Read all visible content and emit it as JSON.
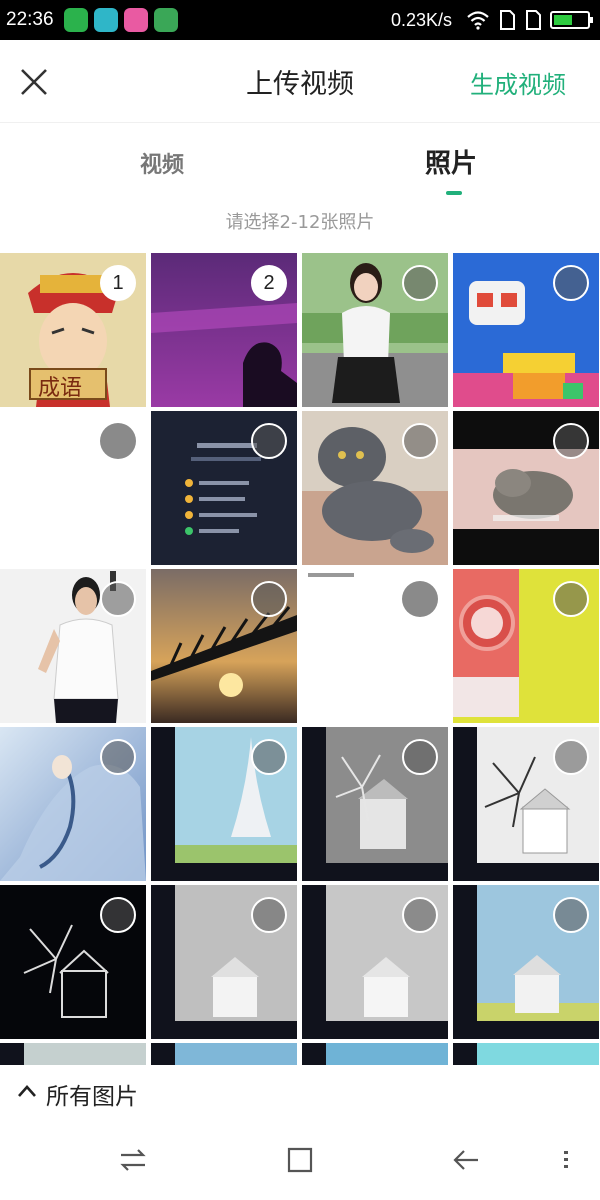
{
  "status_bar": {
    "time": "22:36",
    "speed": "0.23K/s",
    "battery_level": 0.55,
    "notification_colors": [
      "#2bb24c",
      "#2fb6c8",
      "#e95aa2",
      "#3aa757"
    ]
  },
  "header": {
    "title": "上传视频",
    "generate_label": "生成视频"
  },
  "tabs": [
    {
      "label": "视频",
      "active": false
    },
    {
      "label": "照片",
      "active": true
    }
  ],
  "hint": "请选择2-12张照片",
  "photos": [
    {
      "selected": 1
    },
    {
      "selected": 2
    },
    {
      "selected": 0
    },
    {
      "selected": 0
    },
    {
      "selected": 0
    },
    {
      "selected": 0
    },
    {
      "selected": 0
    },
    {
      "selected": 0
    },
    {
      "selected": 0
    },
    {
      "selected": 0
    },
    {
      "selected": 0
    },
    {
      "selected": 0
    },
    {
      "selected": 0
    },
    {
      "selected": 0
    },
    {
      "selected": 0
    },
    {
      "selected": 0
    },
    {
      "selected": 0
    },
    {
      "selected": 0
    },
    {
      "selected": 0
    },
    {
      "selected": 0
    }
  ],
  "thumbnail_text": {
    "idiom": "成语"
  },
  "album": {
    "label": "所有图片"
  },
  "colors": {
    "accent": "#21b07b"
  }
}
